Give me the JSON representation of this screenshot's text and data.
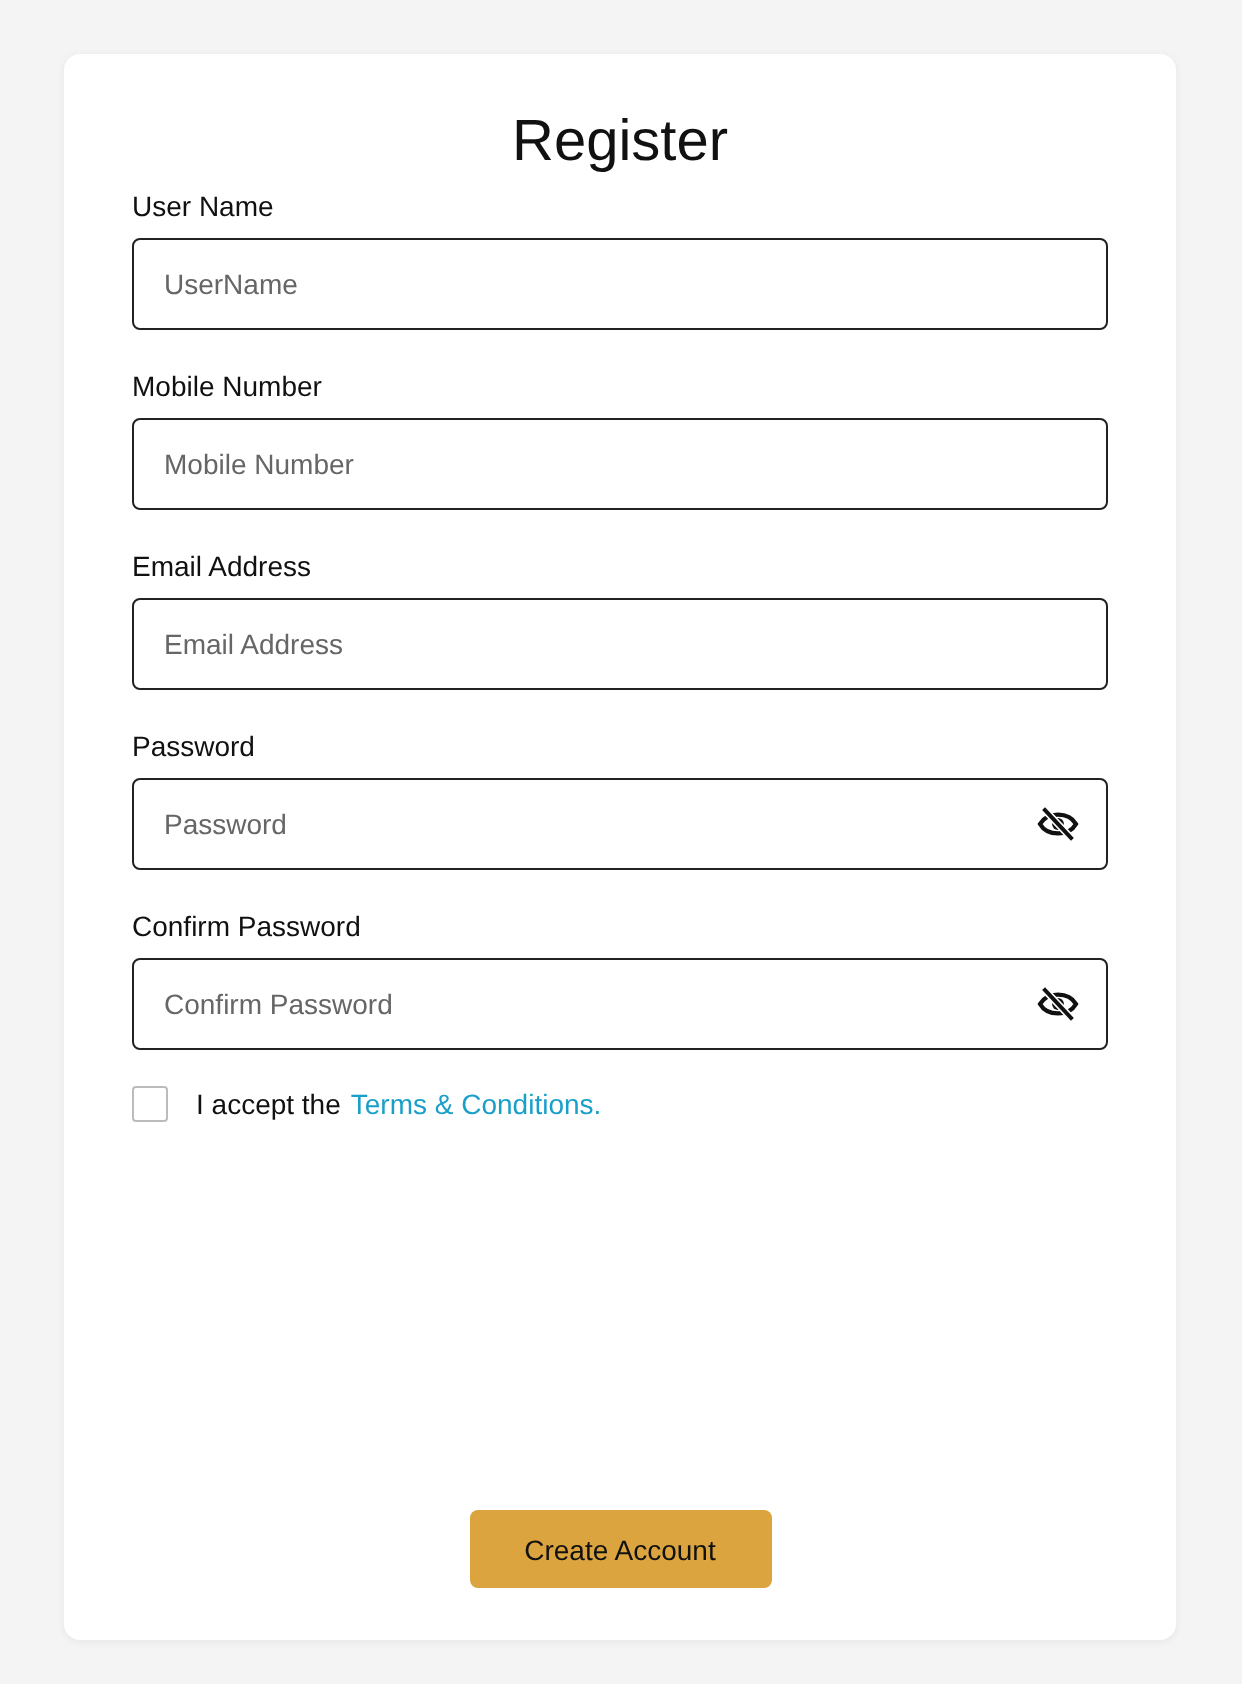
{
  "title": "Register",
  "fields": [
    {
      "label": "User Name",
      "placeholder": "UserName",
      "kind": "text"
    },
    {
      "label": "Mobile Number",
      "placeholder": "Mobile Number",
      "kind": "text"
    },
    {
      "label": "Email Address",
      "placeholder": "Email Address",
      "kind": "text"
    },
    {
      "label": "Password",
      "placeholder": "Password",
      "kind": "password"
    },
    {
      "label": "Confirm Password",
      "placeholder": "Confirm Password",
      "kind": "password"
    }
  ],
  "terms": {
    "checked": false,
    "text": "I accept the",
    "link": "Terms & Conditions."
  },
  "button": "Create Account"
}
